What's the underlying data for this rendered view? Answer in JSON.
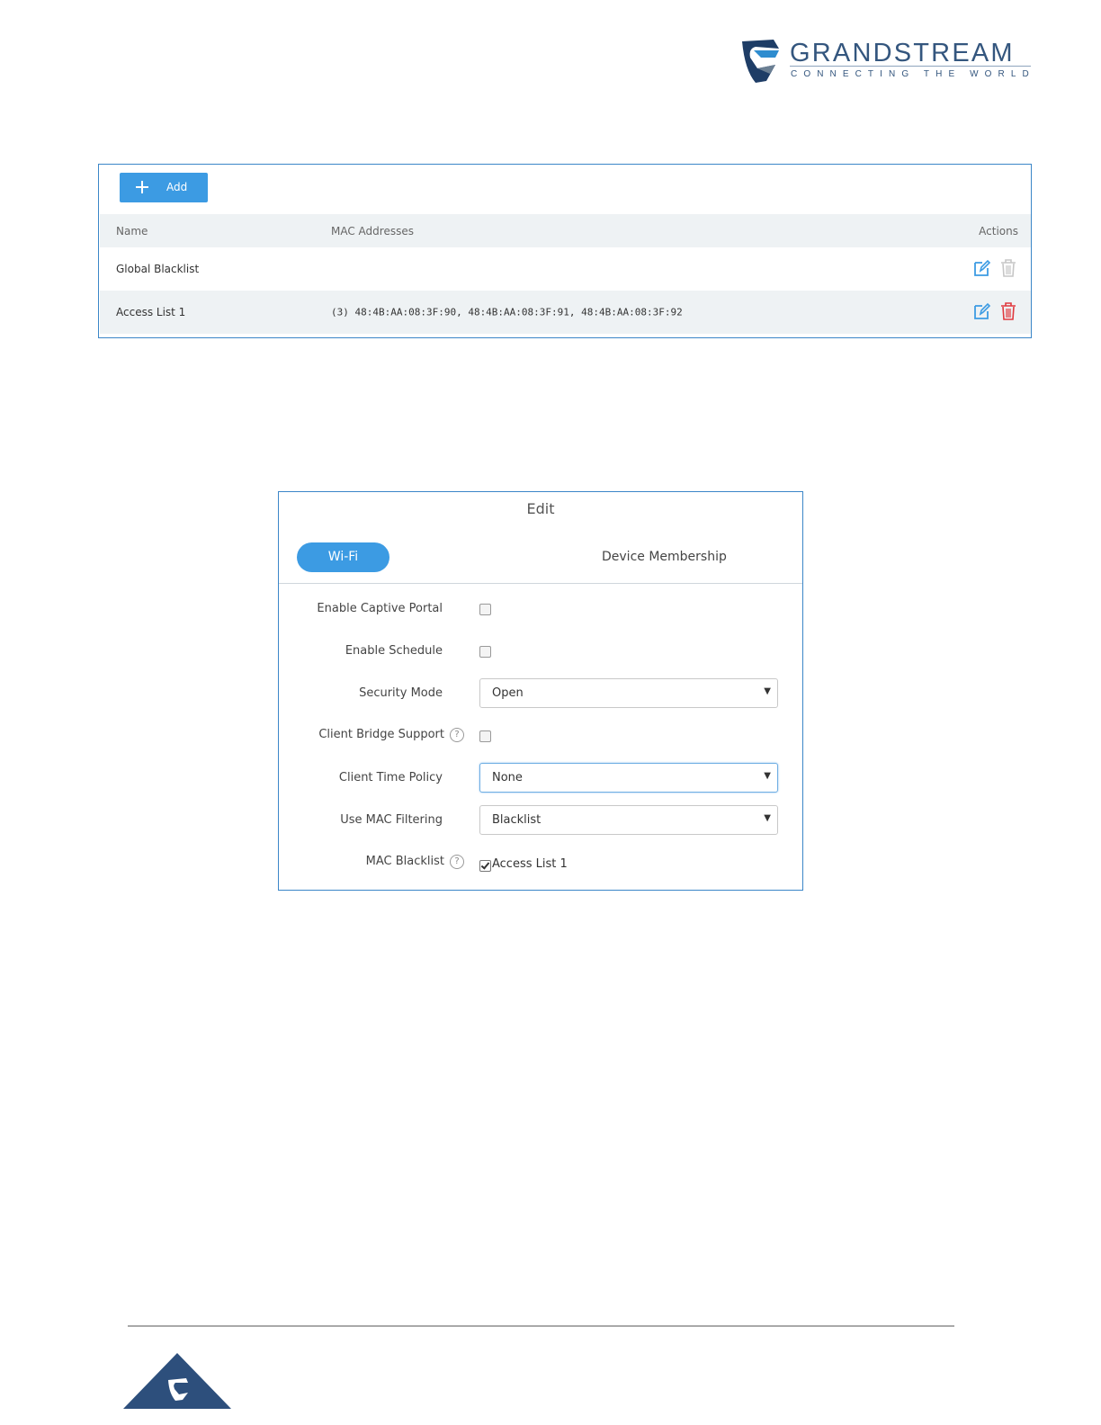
{
  "brand": {
    "name": "GRANDSTREAM",
    "tagline": "CONNECTING THE WORLD",
    "color": "#34567e"
  },
  "access_list": {
    "add_label": "Add",
    "columns": [
      "Name",
      "MAC Addresses",
      "Actions"
    ],
    "rows": [
      {
        "name": "Global Blacklist",
        "macs": ""
      },
      {
        "name": "Access List 1",
        "macs": "(3) 48:4B:AA:08:3F:90, 48:4B:AA:08:3F:91, 48:4B:AA:08:3F:92"
      }
    ],
    "icons": [
      "edit-icon",
      "trash-icon"
    ],
    "accent": "#3c9be3",
    "delete_color": "#e0393e"
  },
  "edit_dialog": {
    "title": "Edit",
    "tabs": [
      "Wi-Fi",
      "Device Membership"
    ],
    "fields": {
      "captive_portal": {
        "label": "Enable Captive Portal",
        "checked": false
      },
      "schedule": {
        "label": "Enable Schedule",
        "checked": false
      },
      "security_mode": {
        "label": "Security Mode",
        "value": "Open"
      },
      "client_bridge": {
        "label": "Client Bridge Support",
        "checked": false
      },
      "client_time_policy": {
        "label": "Client Time Policy",
        "value": "None"
      },
      "mac_filtering": {
        "label": "Use MAC Filtering",
        "value": "Blacklist"
      },
      "mac_blacklist": {
        "label": "MAC Blacklist",
        "option": "Access List 1",
        "checked": true
      }
    },
    "help_glyph": "?",
    "caret_glyph": "▼"
  }
}
